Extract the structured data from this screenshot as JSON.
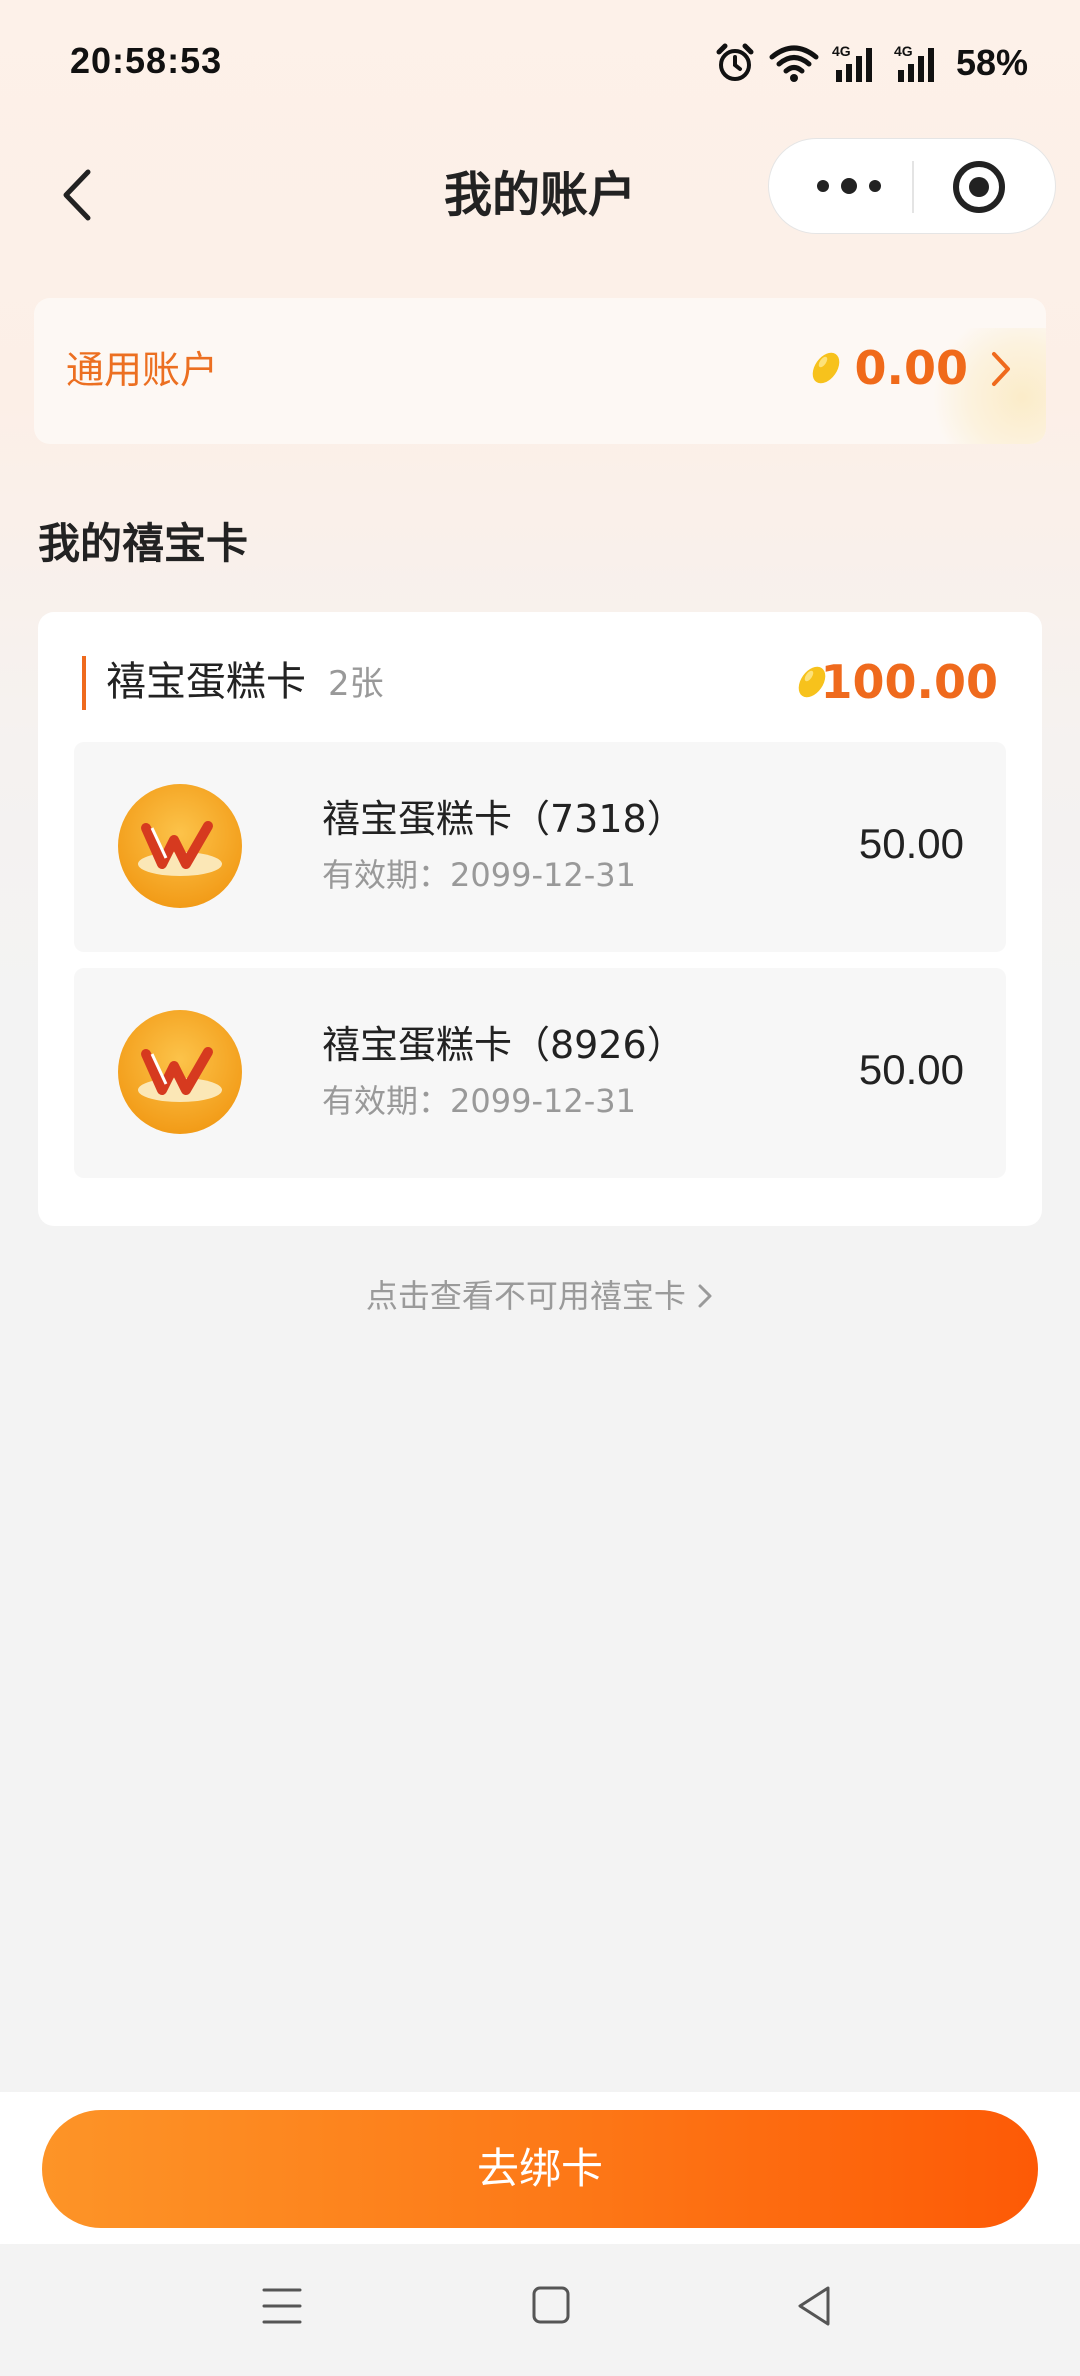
{
  "status_bar": {
    "time": "20:58:53",
    "battery": "58%",
    "icons": [
      "alarm-icon",
      "wifi-icon",
      "signal-4g-icon",
      "signal-4g-icon"
    ]
  },
  "nav": {
    "title": "我的账户",
    "back_icon": "back-arrow-icon",
    "more_icon": "more-dots-icon",
    "target_icon": "target-icon"
  },
  "general_account": {
    "label": "通用账户",
    "amount": "0.00",
    "icon": "bean-icon"
  },
  "section": {
    "title": "我的禧宝卡"
  },
  "card_group": {
    "name": "禧宝蛋糕卡",
    "count": "2张",
    "total": "100.00",
    "cards": [
      {
        "name": "禧宝蛋糕卡（7318）",
        "expiry": "有效期：2099-12-31",
        "amount": "50.00"
      },
      {
        "name": "禧宝蛋糕卡（8926）",
        "expiry": "有效期：2099-12-31",
        "amount": "50.00"
      }
    ]
  },
  "view_unusable": "点击查看不可用禧宝卡",
  "bind_button": "去绑卡",
  "colors": {
    "accent": "#ef6a1d",
    "button_start": "#fd9427",
    "button_end": "#fd5a06"
  }
}
